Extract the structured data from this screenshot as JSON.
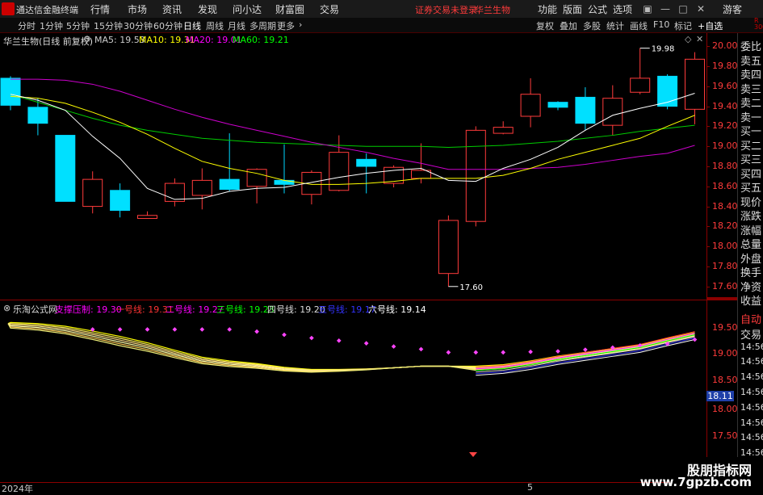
{
  "app": {
    "title": "通达信金融终端",
    "notice": "证券交易未登录",
    "stock_name": "华兰生物"
  },
  "menu": {
    "left": [
      "行情",
      "市场",
      "资讯",
      "发现",
      "问小达",
      "财富圈",
      "交易"
    ],
    "right": [
      "功能",
      "版面",
      "公式",
      "选项"
    ],
    "guest": "游客"
  },
  "toolbar": {
    "periods": [
      "分时",
      "1分钟",
      "5分钟",
      "15分钟",
      "30分钟",
      "60分钟",
      "日线",
      "周线",
      "月线",
      "多周期",
      "更多"
    ],
    "active_period": "日线",
    "right_buttons": [
      "复权",
      "叠加",
      "多股",
      "统计",
      "画线",
      "F10",
      "标记",
      "+自选"
    ]
  },
  "main_chart": {
    "header": "华兰生物(日线 前复权)",
    "ma": [
      {
        "label": "MA5: 19.53",
        "color": "#ffffff"
      },
      {
        "label": "MA10: 19.31",
        "color": "#ffff00"
      },
      {
        "label": "MA20: 19.01",
        "color": "#ff00ff"
      },
      {
        "label": "MA60: 19.21",
        "color": "#00ff00"
      }
    ],
    "high_label": "19.98",
    "low_label": "17.60",
    "y_ticks": [
      "20.00",
      "19.80",
      "19.60",
      "19.40",
      "19.20",
      "19.00",
      "18.80",
      "18.60",
      "18.40",
      "18.20",
      "18.00",
      "17.80",
      "17.60"
    ]
  },
  "sub_chart": {
    "header": "乐淘公式网",
    "items": [
      {
        "label": "支撑压制: 19.30",
        "color": "#ff00ff"
      },
      {
        "label": "一号线: 19.31",
        "color": "#ff3333"
      },
      {
        "label": "二号线: 19.27",
        "color": "#ff00ff"
      },
      {
        "label": "三号线: 19.23",
        "color": "#00ff00"
      },
      {
        "label": "四号线: 19.20",
        "color": "#dddddd"
      },
      {
        "label": "五号线: 19.17",
        "color": "#3333ff"
      },
      {
        "label": "六号线: 19.14",
        "color": "#ffffff"
      }
    ],
    "y_ticks": [
      "19.50",
      "19.00",
      "18.50",
      "18.00",
      "17.50"
    ],
    "current_value": "18.11"
  },
  "side_labels_top": [
    "委比",
    "卖五",
    "卖四",
    "卖三",
    "卖二",
    "卖一",
    "买一",
    "买二",
    "买三",
    "买四",
    "买五",
    "现价",
    "涨跌",
    "涨幅",
    "总量",
    "外盘",
    "换手",
    "净资",
    "收益"
  ],
  "side_labels_bottom": [
    "自动",
    "交易",
    "14:56",
    "14:56",
    "14:56",
    "14:56",
    "14:56",
    "14:56",
    "14:56",
    "14:56"
  ],
  "date_bar": {
    "start": "2024年",
    "mark": "5"
  },
  "watermark": {
    "line1": "股朋指标网",
    "line2": "www.7gpzb.com"
  },
  "chart_data": {
    "type": "candlestick",
    "y_range": [
      17.55,
      20.05
    ],
    "candles": [
      {
        "o": 19.68,
        "c": 19.41,
        "h": 19.7,
        "l": 19.36
      },
      {
        "o": 19.39,
        "c": 19.23,
        "h": 19.48,
        "l": 19.11
      },
      {
        "o": 19.11,
        "c": 18.45,
        "h": 19.11,
        "l": 18.45
      },
      {
        "o": 18.4,
        "c": 18.67,
        "h": 18.75,
        "l": 18.33
      },
      {
        "o": 18.56,
        "c": 18.36,
        "h": 18.63,
        "l": 18.29
      },
      {
        "o": 18.28,
        "c": 18.31,
        "h": 18.35,
        "l": 18.28
      },
      {
        "o": 18.45,
        "c": 18.63,
        "h": 18.68,
        "l": 18.4
      },
      {
        "o": 18.51,
        "c": 18.66,
        "h": 18.78,
        "l": 18.37
      },
      {
        "o": 18.67,
        "c": 18.57,
        "h": 19.13,
        "l": 18.55
      },
      {
        "o": 18.6,
        "c": 18.77,
        "h": 18.78,
        "l": 18.43
      },
      {
        "o": 18.66,
        "c": 18.62,
        "h": 19.02,
        "l": 18.53
      },
      {
        "o": 18.52,
        "c": 18.74,
        "h": 18.76,
        "l": 18.42
      },
      {
        "o": 18.56,
        "c": 18.94,
        "h": 19.11,
        "l": 18.55
      },
      {
        "o": 18.87,
        "c": 18.8,
        "h": 18.93,
        "l": 18.53
      },
      {
        "o": 18.63,
        "c": 18.79,
        "h": 18.81,
        "l": 18.59
      },
      {
        "o": 18.68,
        "c": 18.76,
        "h": 19.03,
        "l": 18.63
      },
      {
        "o": 17.73,
        "c": 18.26,
        "h": 18.31,
        "l": 17.6
      },
      {
        "o": 18.25,
        "c": 19.16,
        "h": 19.2,
        "l": 18.2
      },
      {
        "o": 19.13,
        "c": 19.19,
        "h": 19.25,
        "l": 19.12
      },
      {
        "o": 19.3,
        "c": 19.52,
        "h": 19.68,
        "l": 19.19
      },
      {
        "o": 19.44,
        "c": 19.39,
        "h": 19.45,
        "l": 19.36
      },
      {
        "o": 19.49,
        "c": 19.23,
        "h": 19.59,
        "l": 19.16
      },
      {
        "o": 19.21,
        "c": 19.48,
        "h": 19.61,
        "l": 19.11
      },
      {
        "o": 19.54,
        "c": 19.68,
        "h": 19.98,
        "l": 19.52
      },
      {
        "o": 19.7,
        "c": 19.4,
        "h": 19.72,
        "l": 19.37
      },
      {
        "o": 19.37,
        "c": 19.87,
        "h": 19.94,
        "l": 19.22
      }
    ],
    "ma5": [
      19.52,
      19.46,
      19.36,
      19.1,
      18.88,
      18.58,
      18.47,
      18.48,
      18.55,
      18.58,
      18.59,
      18.64,
      18.69,
      18.73,
      18.76,
      18.78,
      18.66,
      18.65,
      18.78,
      18.87,
      18.99,
      19.16,
      19.31,
      19.38,
      19.44,
      19.53
    ],
    "ma10": [
      19.5,
      19.48,
      19.43,
      19.34,
      19.24,
      19.12,
      18.98,
      18.85,
      18.78,
      18.73,
      18.66,
      18.62,
      18.62,
      18.63,
      18.65,
      18.68,
      18.68,
      18.68,
      18.71,
      18.78,
      18.87,
      18.94,
      19.01,
      19.08,
      19.2,
      19.31
    ],
    "ma20": [
      19.67,
      19.67,
      19.66,
      19.62,
      19.55,
      19.46,
      19.37,
      19.29,
      19.22,
      19.16,
      19.1,
      19.04,
      18.99,
      18.94,
      18.88,
      18.83,
      18.77,
      18.77,
      18.77,
      18.78,
      18.79,
      18.82,
      18.86,
      18.9,
      18.93,
      19.01
    ],
    "ma60": [
      19.52,
      19.44,
      19.36,
      19.28,
      19.21,
      19.16,
      19.12,
      19.08,
      19.06,
      19.04,
      19.03,
      19.02,
      19.01,
      19.0,
      19.0,
      19.0,
      18.99,
      19.0,
      19.01,
      19.03,
      19.05,
      19.08,
      19.11,
      19.15,
      19.18,
      19.21
    ]
  }
}
